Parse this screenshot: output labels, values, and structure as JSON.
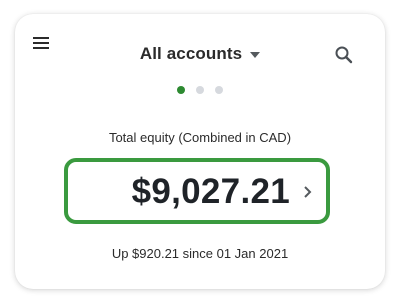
{
  "header": {
    "menu_icon": "hamburger-menu-icon",
    "account_selector_label": "All accounts",
    "account_selector_icon": "caret-down-icon",
    "search_icon": "search-icon"
  },
  "pager": {
    "total_pages": 3,
    "active_page": 1,
    "active_color": "#2d8a31",
    "inactive_color": "#d6d9de"
  },
  "equity": {
    "label": "Total equity (Combined in CAD)",
    "value": "$9,027.21",
    "detail_icon": "chevron-right-icon",
    "highlight_color": "#3a9a3f",
    "change_text": "Up $920.21 since 01 Jan 2021"
  }
}
